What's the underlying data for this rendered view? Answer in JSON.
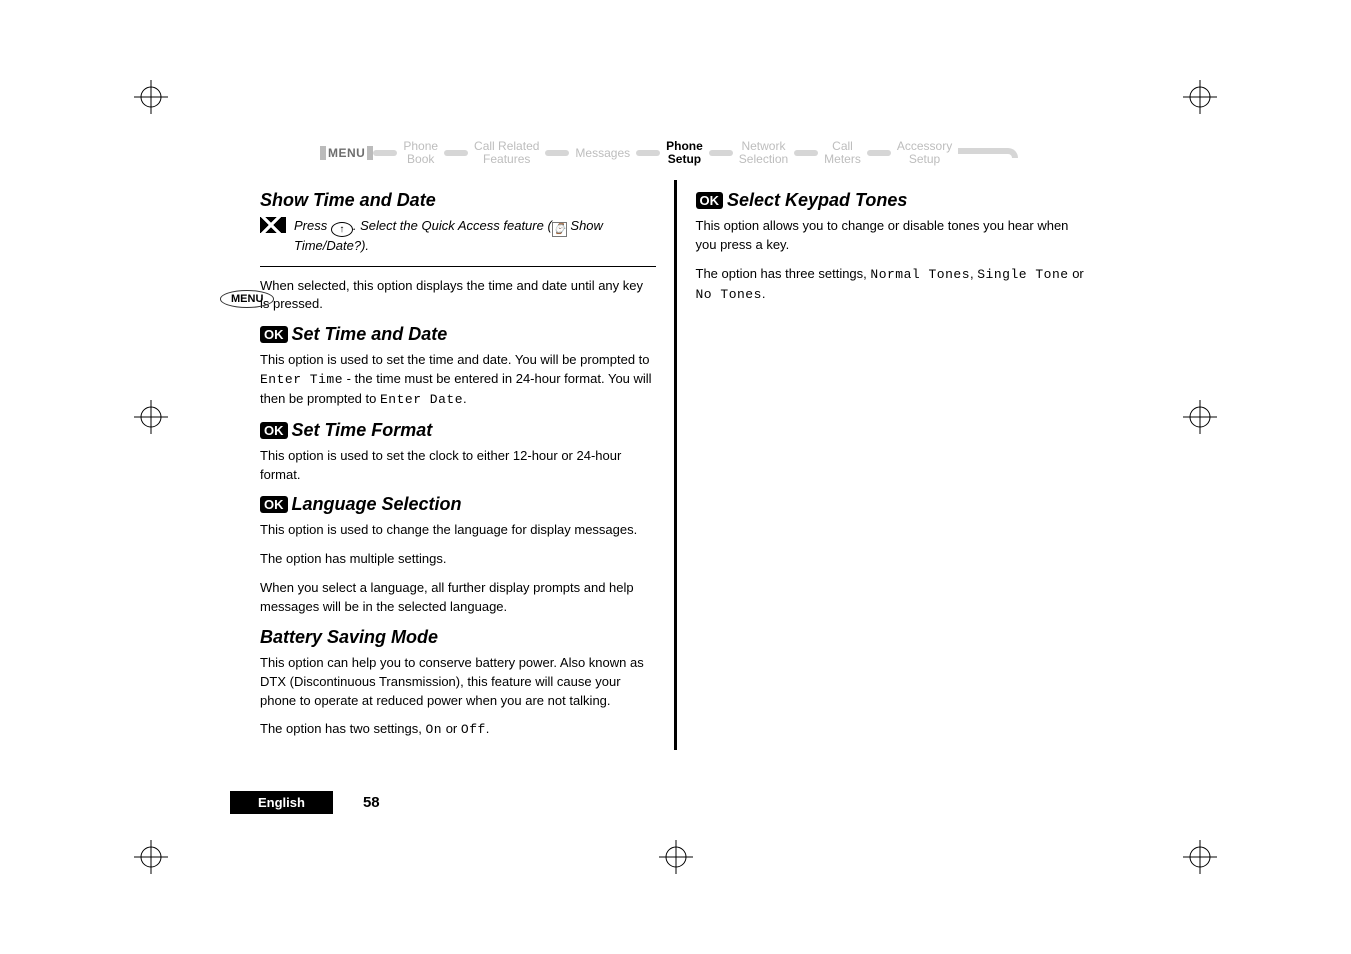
{
  "menubar": {
    "lead": "MENU",
    "items": [
      {
        "l1": "Phone",
        "l2": "Book",
        "current": false
      },
      {
        "l1": "Call Related",
        "l2": "Features",
        "current": false
      },
      {
        "l1": "Messages",
        "l2": "",
        "current": false
      },
      {
        "l1": "Phone",
        "l2": "Setup",
        "current": true
      },
      {
        "l1": "Network",
        "l2": "Selection",
        "current": false
      },
      {
        "l1": "Call",
        "l2": "Meters",
        "current": false
      },
      {
        "l1": "Accessory",
        "l2": "Setup",
        "current": false
      }
    ]
  },
  "side": {
    "menu_label": "MENU"
  },
  "left": {
    "show_time_date": {
      "title": "Show Time and Date",
      "qa_prefix": "Press ",
      "qa_mid": ". Select the Quick Access feature (",
      "qa_feature": "Show Time/Date?",
      "qa_suffix": ").",
      "body": "When selected, this option displays the time and date until any key is pressed."
    },
    "set_time_date": {
      "title": "Set Time and Date",
      "body_1": "This option is used to set the time and date. You will be prompted to ",
      "enter_time": "Enter Time",
      "body_2": " - the time must be entered in 24-hour format. You will then be prompted to ",
      "enter_date": "Enter Date",
      "body_3": "."
    },
    "set_time_format": {
      "title": "Set Time Format",
      "body": "This option is used to set the clock to either 12-hour or 24-hour format."
    },
    "language": {
      "title": "Language Selection",
      "body_1": "This option is used to change the language for display messages.",
      "body_2": "The option has multiple settings.",
      "body_3": "When you select a language, all further display prompts and help messages will be in the selected language."
    },
    "battery": {
      "title": "Battery Saving Mode",
      "body_1": "This option can help you to conserve battery power. Also known as DTX (Discontinuous Transmission), this feature will cause your phone to operate at reduced power when you are not talking.",
      "body_2a": "The option has two settings, ",
      "on": "On",
      "body_2b": " or ",
      "off": "Off",
      "body_2c": "."
    }
  },
  "right": {
    "keypad": {
      "title": "Select Keypad Tones",
      "body_1": "This option allows you to change or disable tones you hear when you press a key.",
      "body_2a": "The option has three settings, ",
      "normal": "Normal Tones",
      "body_2b": ", ",
      "single": "Single Tone",
      "body_2c": " or ",
      "notones": "No Tones",
      "body_2d": "."
    }
  },
  "ok_label": "OK",
  "footer": {
    "lang": "English",
    "page": "58"
  }
}
